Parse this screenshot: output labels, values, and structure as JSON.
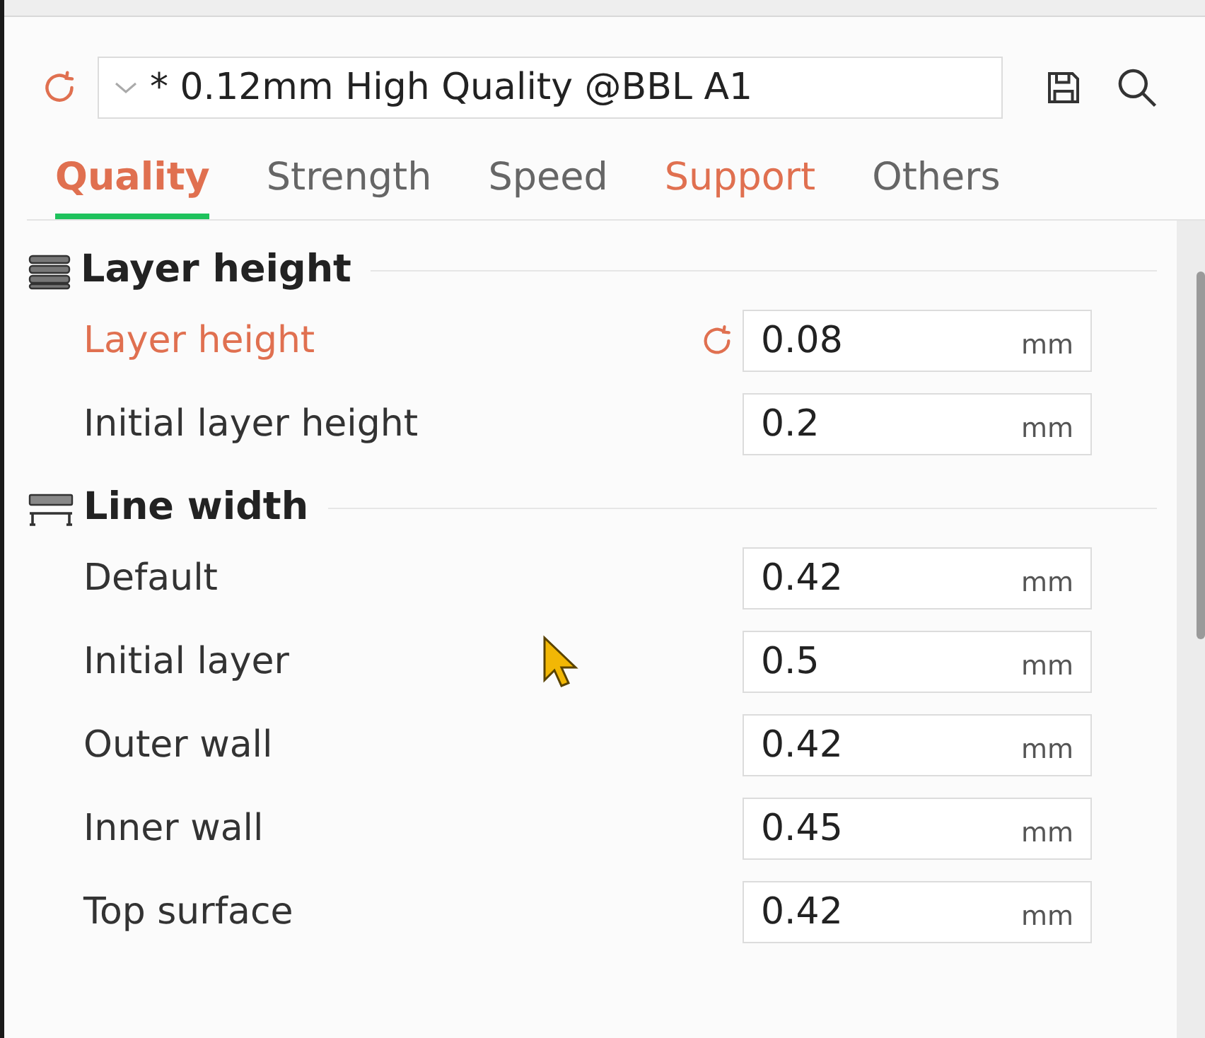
{
  "preset": {
    "modified": true,
    "value": "* 0.12mm High Quality @BBL A1"
  },
  "tabs": [
    {
      "label": "Quality",
      "selected": true,
      "modified": true
    },
    {
      "label": "Strength",
      "selected": false,
      "modified": false
    },
    {
      "label": "Speed",
      "selected": false,
      "modified": false
    },
    {
      "label": "Support",
      "selected": false,
      "modified": true
    },
    {
      "label": "Others",
      "selected": false,
      "modified": false
    }
  ],
  "groups": [
    {
      "kind": "layers",
      "title": "Layer height",
      "settings": [
        {
          "label": "Layer height",
          "modified": true,
          "value": "0.08",
          "unit": "mm"
        },
        {
          "label": "Initial layer height",
          "modified": false,
          "value": "0.2",
          "unit": "mm"
        }
      ]
    },
    {
      "kind": "lines",
      "title": "Line width",
      "settings": [
        {
          "label": "Default",
          "modified": false,
          "value": "0.42",
          "unit": "mm"
        },
        {
          "label": "Initial layer",
          "modified": false,
          "value": "0.5",
          "unit": "mm"
        },
        {
          "label": "Outer wall",
          "modified": false,
          "value": "0.42",
          "unit": "mm"
        },
        {
          "label": "Inner wall",
          "modified": false,
          "value": "0.45",
          "unit": "mm"
        },
        {
          "label": "Top surface",
          "modified": false,
          "value": "0.42",
          "unit": "mm"
        }
      ]
    }
  ]
}
